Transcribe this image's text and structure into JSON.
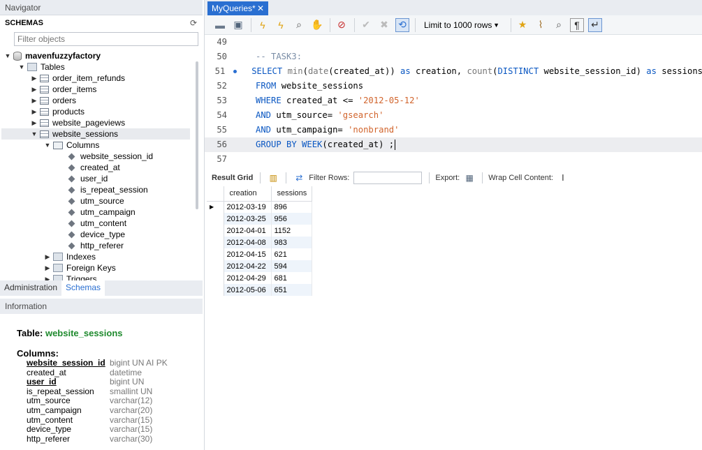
{
  "navigator": {
    "title": "Navigator",
    "schemas_label": "SCHEMAS",
    "refresh_icon": "refresh-icon",
    "filter_placeholder": "Filter objects",
    "tree": {
      "schema": "mavenfuzzyfactory",
      "tables_label": "Tables",
      "tables": [
        "order_item_refunds",
        "order_items",
        "orders",
        "products",
        "website_pageviews",
        "website_sessions"
      ],
      "columns_label": "Columns",
      "columns": [
        "website_session_id",
        "created_at",
        "user_id",
        "is_repeat_session",
        "utm_source",
        "utm_campaign",
        "utm_content",
        "device_type",
        "http_referer"
      ],
      "indexes_label": "Indexes",
      "foreign_keys_label": "Foreign Keys",
      "triggers_label": "Triggers"
    },
    "tabs": [
      "Administration",
      "Schemas"
    ],
    "active_tab": "Schemas"
  },
  "information": {
    "title": "Information",
    "table_label": "Table:",
    "table_name": "website_sessions",
    "columns_label": "Columns:",
    "columns": [
      {
        "name": "website_session_id",
        "type": "bigint UN AI PK",
        "pk": true
      },
      {
        "name": "created_at",
        "type": "datetime",
        "pk": false
      },
      {
        "name": "user_id",
        "type": "bigint UN",
        "pk": true
      },
      {
        "name": "is_repeat_session",
        "type": "smallint UN",
        "pk": false
      },
      {
        "name": "utm_source",
        "type": "varchar(12)",
        "pk": false
      },
      {
        "name": "utm_campaign",
        "type": "varchar(20)",
        "pk": false
      },
      {
        "name": "utm_content",
        "type": "varchar(15)",
        "pk": false
      },
      {
        "name": "device_type",
        "type": "varchar(15)",
        "pk": false
      },
      {
        "name": "http_referer",
        "type": "varchar(30)",
        "pk": false
      }
    ]
  },
  "editor": {
    "tab_label": "MyQueries*",
    "limit_label": "Limit to 1000 rows",
    "lines": [
      {
        "num": "49",
        "parts": []
      },
      {
        "num": "50",
        "parts": [
          {
            "t": "-- TASK3:",
            "c": "cmt"
          }
        ]
      },
      {
        "num": "51",
        "bp": true,
        "parts": [
          {
            "t": "SELECT ",
            "c": "kw"
          },
          {
            "t": "min",
            "c": "fn"
          },
          {
            "t": "(",
            "c": ""
          },
          {
            "t": "date",
            "c": "fn"
          },
          {
            "t": "(created_at)) ",
            "c": ""
          },
          {
            "t": "as",
            "c": "kw"
          },
          {
            "t": " creation, ",
            "c": ""
          },
          {
            "t": "count",
            "c": "fn"
          },
          {
            "t": "(",
            "c": ""
          },
          {
            "t": "DISTINCT",
            "c": "kw"
          },
          {
            "t": " website_session_id) ",
            "c": ""
          },
          {
            "t": "as",
            "c": "kw"
          },
          {
            "t": " sessions",
            "c": ""
          }
        ]
      },
      {
        "num": "52",
        "parts": [
          {
            "t": "FROM",
            "c": "kw"
          },
          {
            "t": " website_sessions",
            "c": ""
          }
        ]
      },
      {
        "num": "53",
        "parts": [
          {
            "t": "WHERE",
            "c": "kw"
          },
          {
            "t": " created_at <= ",
            "c": ""
          },
          {
            "t": "'2012-05-12'",
            "c": "str"
          }
        ]
      },
      {
        "num": "54",
        "parts": [
          {
            "t": "AND",
            "c": "kw"
          },
          {
            "t": " utm_source= ",
            "c": ""
          },
          {
            "t": "'gsearch'",
            "c": "str"
          }
        ]
      },
      {
        "num": "55",
        "parts": [
          {
            "t": "AND",
            "c": "kw"
          },
          {
            "t": " utm_campaign= ",
            "c": ""
          },
          {
            "t": "'nonbrand'",
            "c": "str"
          }
        ]
      },
      {
        "num": "56",
        "cur": true,
        "parts": [
          {
            "t": "GROUP BY ",
            "c": "kw"
          },
          {
            "t": "WEEK",
            "c": "kw"
          },
          {
            "t": "(created_at) ;",
            "c": ""
          }
        ]
      },
      {
        "num": "57",
        "parts": []
      }
    ]
  },
  "results": {
    "grid_label": "Result Grid",
    "filter_label": "Filter Rows:",
    "export_label": "Export:",
    "wrap_label": "Wrap Cell Content:",
    "columns": [
      "creation",
      "sessions"
    ],
    "rows": [
      [
        "2012-03-19",
        "896"
      ],
      [
        "2012-03-25",
        "956"
      ],
      [
        "2012-04-01",
        "1152"
      ],
      [
        "2012-04-08",
        "983"
      ],
      [
        "2012-04-15",
        "621"
      ],
      [
        "2012-04-22",
        "594"
      ],
      [
        "2012-04-29",
        "681"
      ],
      [
        "2012-05-06",
        "651"
      ]
    ]
  }
}
